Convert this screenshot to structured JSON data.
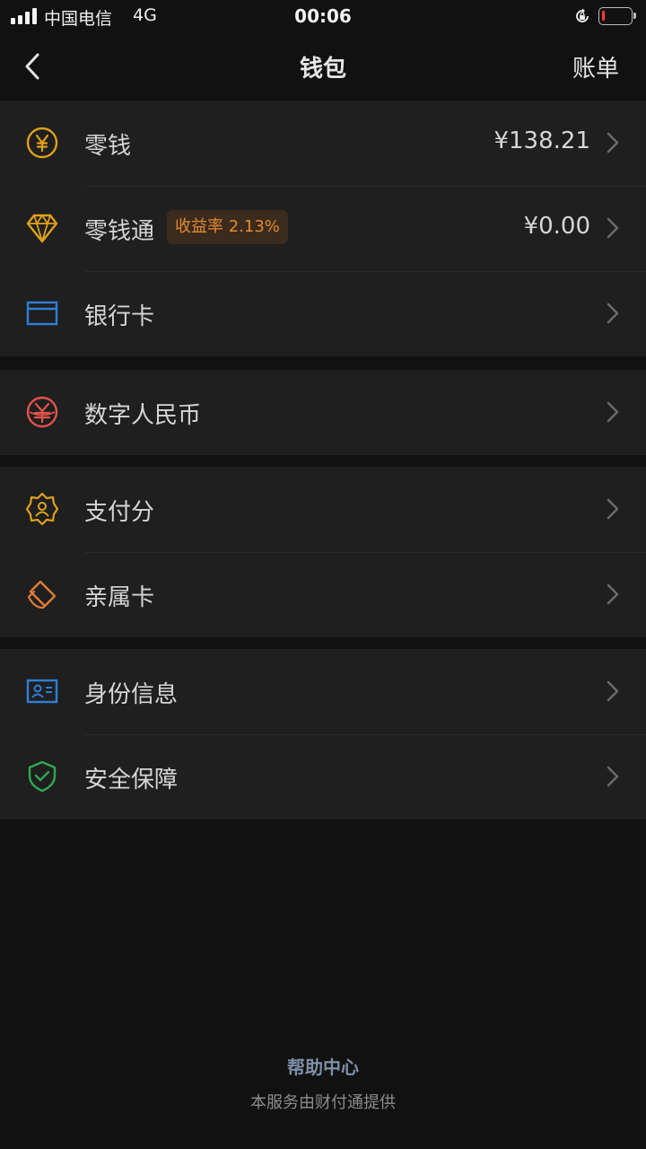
{
  "status_bar": {
    "carrier": "中国电信",
    "network": "4G",
    "time": "00:06"
  },
  "nav": {
    "title": "钱包",
    "action_label": "账单"
  },
  "groups": [
    {
      "items": [
        {
          "label": "零钱",
          "value": "¥138.21",
          "icon": "yuan-coin-icon",
          "icon_color": "#e0a11b"
        },
        {
          "label": "零钱通",
          "badge": "收益率 2.13%",
          "value": "¥0.00",
          "icon": "diamond-icon",
          "icon_color": "#e0a11b"
        },
        {
          "label": "银行卡",
          "icon": "bank-card-icon",
          "icon_color": "#2e7fd6"
        }
      ]
    },
    {
      "items": [
        {
          "label": "数字人民币",
          "icon": "digital-rmb-icon",
          "icon_color": "#e5534b"
        }
      ]
    },
    {
      "items": [
        {
          "label": "支付分",
          "icon": "pay-score-badge-icon",
          "icon_color": "#e0a11b"
        },
        {
          "label": "亲属卡",
          "icon": "family-card-icon",
          "icon_color": "#e07b39"
        }
      ]
    },
    {
      "items": [
        {
          "label": "身份信息",
          "icon": "id-card-icon",
          "icon_color": "#2e7fd6"
        },
        {
          "label": "安全保障",
          "icon": "security-shield-icon",
          "icon_color": "#2fa84f"
        }
      ]
    }
  ],
  "footer": {
    "help_link": "帮助中心",
    "note": "本服务由财付通提供"
  },
  "colors": {
    "background": "#111111",
    "row_background": "#1f1f1f",
    "badge_background": "#3b2b1c",
    "badge_text": "#e48a33",
    "help_link": "#7e90a8"
  }
}
